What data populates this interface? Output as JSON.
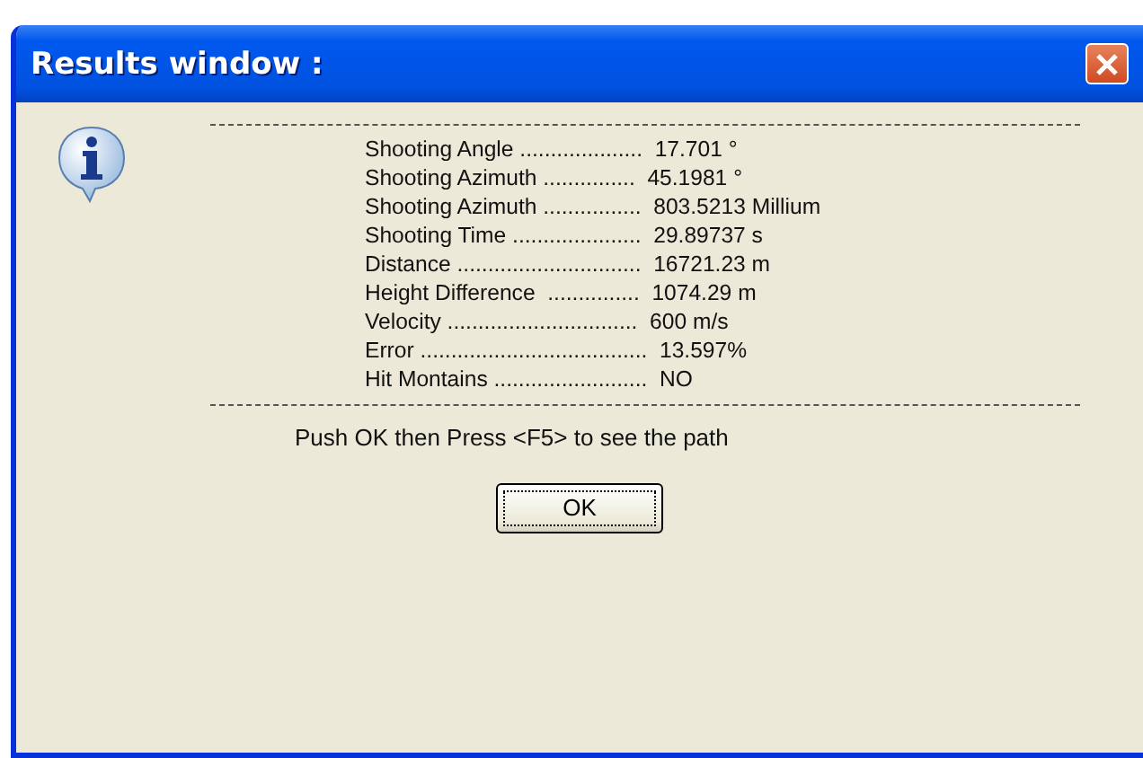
{
  "window": {
    "title": "Results window :"
  },
  "results": [
    "Shooting Angle ....................  17.701 °",
    "Shooting Azimuth ...............  45.1981 °",
    "Shooting Azimuth ................  803.5213 Millium",
    "Shooting Time .....................  29.89737 s",
    "Distance ..............................  16721.23 m",
    "Height Difference  ...............  1074.29 m",
    "Velocity ...............................  600 m/s",
    "Error .....................................  13.597%",
    "Hit Montains .........................  NO"
  ],
  "message": "Push OK then Press <F5> to see the path",
  "buttons": [
    {
      "label": "OK",
      "focused": true
    }
  ]
}
